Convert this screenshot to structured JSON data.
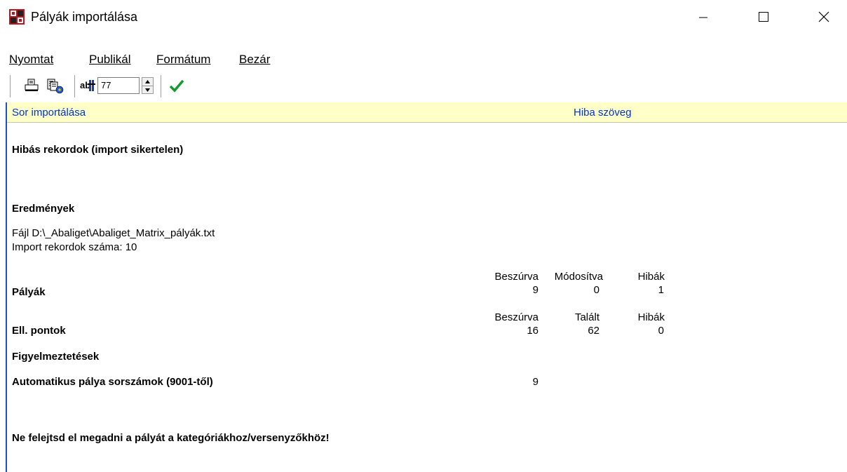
{
  "window": {
    "title": "Pályák importálása"
  },
  "menu": [
    "Nyomtat",
    "Publikál",
    "Formátum",
    "Bezár"
  ],
  "toolbar": {
    "spin_value": "77"
  },
  "columns": {
    "col1": "Sor importálása",
    "col2": "Hiba szöveg"
  },
  "report": {
    "failed_title": "Hibás rekordok (import sikertelen)",
    "results_title": "Eredmények",
    "file_line": "Fájl D:\\_Abaliget\\Abaliget_Matrix_pályák.txt",
    "count_line": "Import rekordok száma: 10",
    "courses": {
      "label": "Pályák",
      "h1": "Beszúrva",
      "h2": "Módosítva",
      "h3": "Hibák",
      "v1": "9",
      "v2": "0",
      "v3": "1"
    },
    "controls": {
      "label": "Ell. pontok",
      "h1": "Beszúrva",
      "h2": "Talált",
      "h3": "Hibák",
      "v1": "16",
      "v2": "62",
      "v3": "0"
    },
    "warnings_title": "Figyelmeztetések",
    "auto_numbers_label": "Automatikus pálya sorszámok (9001-től)",
    "auto_numbers_value": "9",
    "reminder": "Ne felejtsd el megadni a pályát a kategóriákhoz/versenyzőkhöz!"
  }
}
